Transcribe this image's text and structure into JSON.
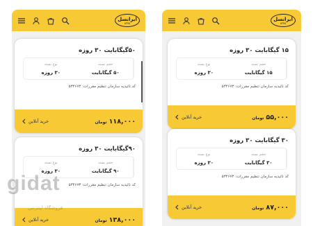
{
  "colors": {
    "accent": "#f7c934",
    "card": "#ffffff",
    "background": "#f1f1f1"
  },
  "topbar": {
    "logo_text": "ایرانسل",
    "logo_sub": "MTN",
    "icons": [
      "menu-icon",
      "user-icon",
      "basket-icon",
      "search-icon"
    ]
  },
  "left_screen": {
    "cards": [
      {
        "title": "۵۰گیگابایت ۳۰ روزه",
        "col1_header": "حجم بسته",
        "col1_value": "۵۰ گیگابایت",
        "col2_header": "نوع بسته",
        "col2_value": "۳۰ روزه",
        "code": "کد تائیدیه سازمان تنظیم مقررات: ۵۳۴۶۷۳",
        "price": "۱۱۸,۰۰۰",
        "unit": "تومان",
        "buy": "خرید آنلاین"
      },
      {
        "title": "۹۰گیگابایت ۳۰ روزه",
        "col1_header": "حجم بسته",
        "col1_value": "۹۰ گیگابایت",
        "col2_header": "نوع بسته",
        "col2_value": "۳۰ روزه",
        "code": "کد تائیدیه سازمان تنظیم مقررات: ۵۳۴۶۷۳",
        "price": "۱۳۸,۰۰۰",
        "unit": "تومان",
        "buy": "خرید آنلاین"
      }
    ]
  },
  "right_screen": {
    "cards": [
      {
        "title": "۱۵ گیگابایت ۳۰ روزه",
        "col1_header": "حجم بسته",
        "col1_value": "۱۵ گیگابایت",
        "col2_header": "نوع بسته",
        "col2_value": "۳۰ روزه",
        "code": "کد تائیدیه سازمان تنظیم مقررات: ۵۳۴۶۷۳",
        "price": "۵۵,۰۰۰",
        "unit": "تومان",
        "buy": "خرید آنلاین"
      },
      {
        "title": "۳۰ گیگابایت ۳۰ روزه",
        "col1_header": "حجم بسته",
        "col1_value": "۳۰ گیگابایت",
        "col2_header": "نوع بسته",
        "col2_value": "۳۰ روزه",
        "code": "کد تائیدیه سازمان تنظیم مقررات: ۵۳۴۶۷۳",
        "price": "۸۷,۰۰۰",
        "unit": "تومان",
        "buy": "خرید آنلاین"
      }
    ]
  },
  "watermark": {
    "brand": "gidat",
    "tagline": "فروشگاه اینترنتی"
  }
}
